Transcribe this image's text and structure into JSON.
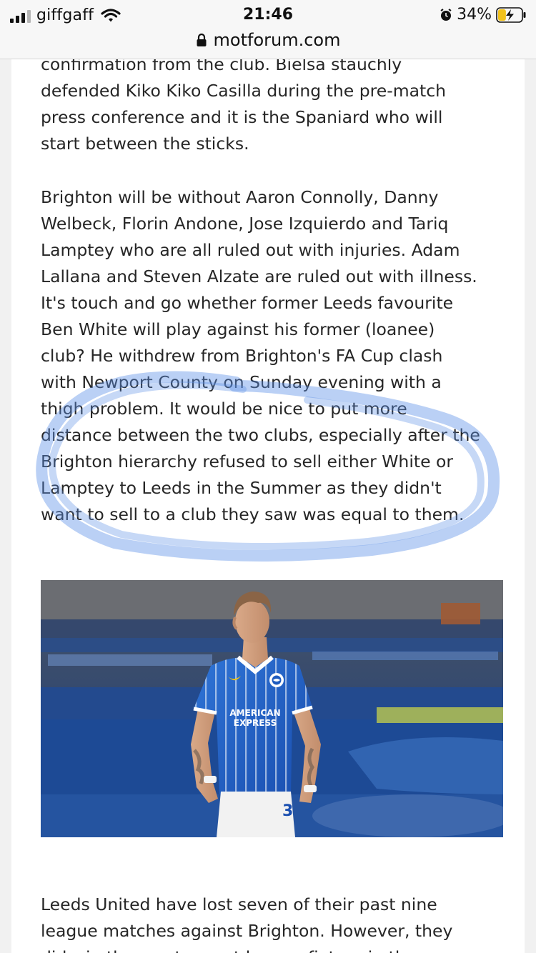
{
  "status_bar": {
    "carrier": "giffgaff",
    "time": "21:46",
    "battery_percent": "34%",
    "battery_level": 0.34
  },
  "browser": {
    "domain": "motforum.com"
  },
  "article": {
    "paragraphs": [
      "confirmation from the club. Bielsa stauchly\ndefended Kiko Kiko Casilla during the pre-match\npress conference and it is the Spaniard who will\nstart between the sticks.",
      "Brighton will be without Aaron Connolly, Danny\nWelbeck, Florin Andone, Jose Izquierdo and Tariq\nLamptey who are all ruled out with injuries. Adam\nLallana and Steven Alzate are ruled out with illness.\nIt's touch and go whether former Leeds favourite\nBen White will play against his former (loanee)\nclub? He withdrew from Brighton's FA Cup clash\nwith Newport County on Sunday evening with a\nthigh problem. It would be nice to put more\ndistance between the two clubs, especially after the\nBrighton hierarchy refused to sell either White or\nLamptey to Leeds in the Summer as they didn't\nwant to sell to a club they saw was equal to them.",
      "Leeds United have lost seven of their past nine\nleague matches against Brighton. However, they\ndid win the most recent league fixture in the"
    ],
    "photo": {
      "shirt_sponsor": "AMERICAN\nEXPRESS",
      "shirt_sponsor_line1": "AMERICAN",
      "shirt_sponsor_line2": "EXPRESS",
      "shirt_number": "3"
    }
  },
  "annotation": {
    "highlight_color": "#5b8fe6"
  }
}
